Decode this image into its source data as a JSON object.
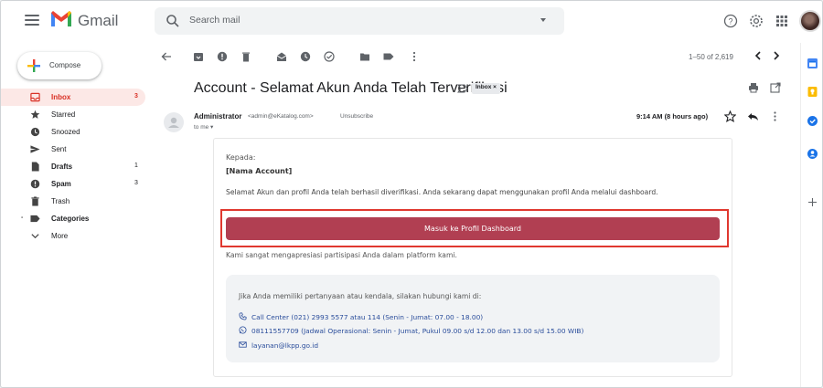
{
  "app": {
    "logo_text": "Gmail",
    "search_placeholder": "Search mail"
  },
  "sidebar": {
    "compose_label": "Compose",
    "items": [
      {
        "label": "Inbox",
        "count": "3",
        "icon": "inbox-icon"
      },
      {
        "label": "Starred",
        "count": "",
        "icon": "star-icon"
      },
      {
        "label": "Snoozed",
        "count": "",
        "icon": "clock-icon"
      },
      {
        "label": "Sent",
        "count": "",
        "icon": "send-icon"
      },
      {
        "label": "Drafts",
        "count": "1",
        "icon": "draft-icon"
      },
      {
        "label": "Spam",
        "count": "3",
        "icon": "spam-icon"
      },
      {
        "label": "Trash",
        "count": "",
        "icon": "trash-icon"
      },
      {
        "label": "Categories",
        "count": "",
        "icon": "label-icon"
      },
      {
        "label": "More",
        "count": "",
        "icon": "chevron-down-icon"
      }
    ]
  },
  "toolbar": {
    "pager_text": "1–50 of 2,619"
  },
  "email": {
    "subject": "Account - Selamat Akun Anda Telah Terverifikasi",
    "label_chip": "Inbox ×",
    "sender_name": "Administrator",
    "sender_email": "<admin@eKatalog.com>",
    "unsubscribe": "Unsubscribe",
    "to_me": "to me ▾",
    "date": "9:14 AM (8 hours ago)",
    "body": {
      "greeting": "Kepada:",
      "recipient": "[Nama Account]",
      "intro": "Selamat Akun dan profil Anda telah berhasil diverifikasi. Anda sekarang dapat menggunakan profil Anda melalui dashboard.",
      "cta_label": "Masuk ke Profil Dashboard",
      "appreciation": "Kami sangat mengapresiasi partisipasi Anda dalam platform kami.",
      "contact_question": "Jika Anda memiliki pertanyaan atau kendala, silakan hubungi kami di:",
      "call_center": "Call Center (021) 2993 5577 atau 114 (Senin - Jumat: 07.00 - 18.00)",
      "whatsapp": "08111557709 (Jadwal Operasional: Senin - Jumat, Pukul 09.00 s/d 12.00 dan  13.00 s/d 15.00 WIB)",
      "email": "layanan@lkpp.go.id"
    }
  },
  "colors": {
    "cta": "#b13f52",
    "highlight_border": "#e0382f",
    "inbox_active_bg": "#fce8e6",
    "link_blue": "#2a4d9b"
  }
}
